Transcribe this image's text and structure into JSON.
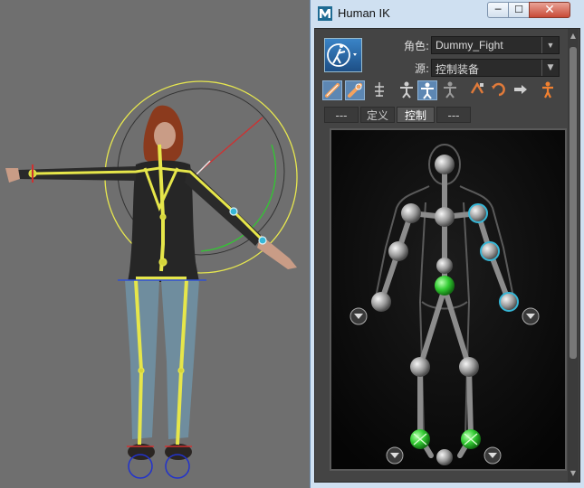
{
  "window": {
    "title": "Human IK",
    "logo_letter": "M",
    "controls": {
      "minimize": "─",
      "maximize": "☐",
      "close": "✕"
    }
  },
  "header": {
    "character_label": "角色:",
    "character_value": "Dummy_Fight",
    "source_label": "源:",
    "source_value": "控制装备"
  },
  "toolbar": {
    "icons": [
      "pin-translation-icon",
      "pin-rotation-icon",
      "full-body-icon",
      "body-part-icon",
      "selection-icon",
      "fk-icon",
      "pose-icon",
      "stance-icon",
      "mirror-icon",
      "person-icon"
    ],
    "active": [
      0,
      1,
      4
    ]
  },
  "tabs": [
    {
      "label": "---",
      "active": false
    },
    {
      "label": "定义",
      "active": false
    },
    {
      "label": "控制",
      "active": true
    },
    {
      "label": "---",
      "active": false
    }
  ],
  "colors": {
    "accent": "#5d87b3",
    "effector_selected": "#36b6d6",
    "effector_pinned": "#33cc33",
    "rig_yellow": "#e6e64a"
  }
}
